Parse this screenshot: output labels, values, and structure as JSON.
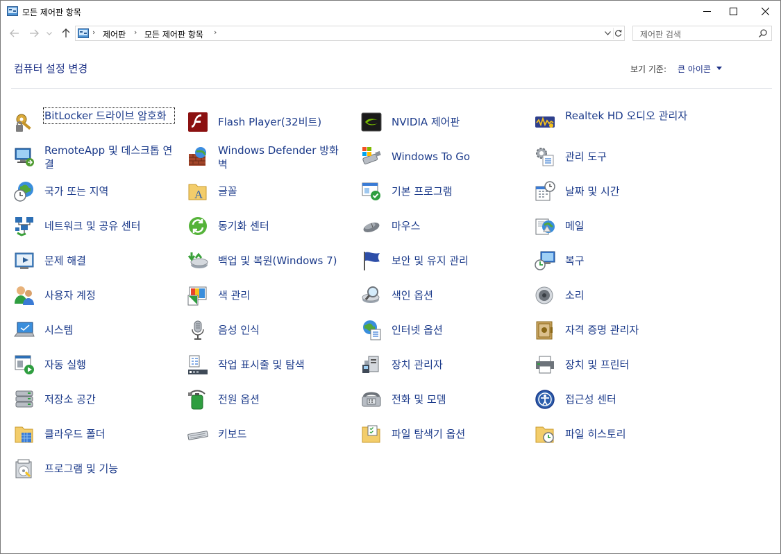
{
  "window": {
    "title": "모든 제어판 항목"
  },
  "nav": {
    "crumbs": [
      "제어판",
      "모든 제어판 항목"
    ],
    "search_placeholder": "제어판 검색"
  },
  "header": {
    "title": "컴퓨터 설정 변경",
    "view_label": "보기 기준:",
    "view_value": "큰 아이콘"
  },
  "colors": {
    "link": "#1b3a8a",
    "title_blue": "#1e3287"
  },
  "items": [
    {
      "label": "BitLocker 드라이브 암호화",
      "icon": "bitlocker-key-icon",
      "lines": 2,
      "focused": true
    },
    {
      "label": "Flash Player(32비트)",
      "icon": "flash-player-icon",
      "lines": 1
    },
    {
      "label": "NVIDIA 제어판",
      "icon": "nvidia-icon",
      "lines": 1
    },
    {
      "label": "Realtek HD 오디오 관리자",
      "icon": "realtek-audio-icon",
      "lines": 2
    },
    {
      "label": "RemoteApp 및 데스크톱 연결",
      "icon": "remoteapp-icon",
      "lines": 2
    },
    {
      "label": "Windows Defender 방화벽",
      "icon": "firewall-icon",
      "lines": 2
    },
    {
      "label": "Windows To Go",
      "icon": "usb-drive-icon",
      "lines": 1
    },
    {
      "label": "관리 도구",
      "icon": "admin-tools-icon",
      "lines": 1
    },
    {
      "label": "국가 또는 지역",
      "icon": "globe-clock-icon",
      "lines": 1
    },
    {
      "label": "글꼴",
      "icon": "fonts-folder-icon",
      "lines": 1
    },
    {
      "label": "기본 프로그램",
      "icon": "default-programs-icon",
      "lines": 1
    },
    {
      "label": "날짜 및 시간",
      "icon": "calendar-clock-icon",
      "lines": 1
    },
    {
      "label": "네트워크 및 공유 센터",
      "icon": "network-icon",
      "lines": 1
    },
    {
      "label": "동기화 센터",
      "icon": "sync-icon",
      "lines": 1
    },
    {
      "label": "마우스",
      "icon": "mouse-icon",
      "lines": 1
    },
    {
      "label": "메일",
      "icon": "mail-icon",
      "lines": 1
    },
    {
      "label": "문제 해결",
      "icon": "troubleshoot-icon",
      "lines": 1
    },
    {
      "label": "백업 및 복원(Windows 7)",
      "icon": "backup-icon",
      "lines": 1
    },
    {
      "label": "보안 및 유지 관리",
      "icon": "flag-icon",
      "lines": 1
    },
    {
      "label": "복구",
      "icon": "recovery-icon",
      "lines": 1
    },
    {
      "label": "사용자 계정",
      "icon": "user-accounts-icon",
      "lines": 1
    },
    {
      "label": "색 관리",
      "icon": "color-management-icon",
      "lines": 1
    },
    {
      "label": "색인 옵션",
      "icon": "indexing-icon",
      "lines": 1
    },
    {
      "label": "소리",
      "icon": "speaker-icon",
      "lines": 1
    },
    {
      "label": "시스템",
      "icon": "system-laptop-icon",
      "lines": 1
    },
    {
      "label": "음성 인식",
      "icon": "microphone-icon",
      "lines": 1
    },
    {
      "label": "인터넷 옵션",
      "icon": "internet-options-icon",
      "lines": 1
    },
    {
      "label": "자격 증명 관리자",
      "icon": "credential-vault-icon",
      "lines": 1
    },
    {
      "label": "자동 실행",
      "icon": "autoplay-icon",
      "lines": 1
    },
    {
      "label": "작업 표시줄 및 탐색",
      "icon": "taskbar-icon",
      "lines": 1
    },
    {
      "label": "장치 관리자",
      "icon": "device-manager-icon",
      "lines": 1
    },
    {
      "label": "장치 및 프린터",
      "icon": "printer-icon",
      "lines": 1
    },
    {
      "label": "저장소 공간",
      "icon": "storage-spaces-icon",
      "lines": 1
    },
    {
      "label": "전원 옵션",
      "icon": "power-battery-icon",
      "lines": 1
    },
    {
      "label": "전화 및 모뎀",
      "icon": "phone-modem-icon",
      "lines": 1
    },
    {
      "label": "접근성 센터",
      "icon": "ease-of-access-icon",
      "lines": 1
    },
    {
      "label": "클라우드 폴더",
      "icon": "cloud-folder-icon",
      "lines": 1
    },
    {
      "label": "키보드",
      "icon": "keyboard-icon",
      "lines": 1
    },
    {
      "label": "파일 탐색기 옵션",
      "icon": "folder-options-icon",
      "lines": 1
    },
    {
      "label": "파일 히스토리",
      "icon": "file-history-icon",
      "lines": 1
    },
    {
      "label": "프로그램 및 기능",
      "icon": "programs-features-icon",
      "lines": 1
    }
  ]
}
